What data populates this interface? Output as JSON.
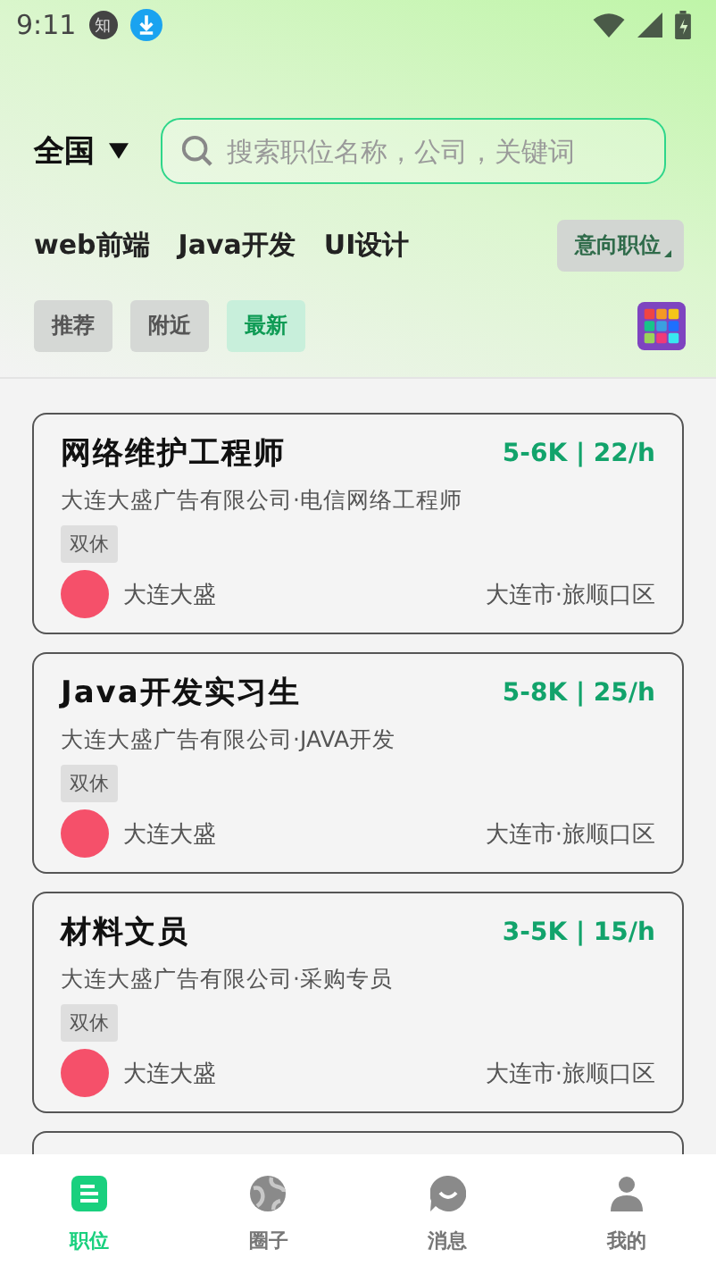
{
  "status_bar": {
    "time": "9:11",
    "app_badge": "知"
  },
  "location": {
    "label": "全国"
  },
  "search": {
    "placeholder": "搜索职位名称，公司，关键词"
  },
  "categories": [
    {
      "label": "web前端"
    },
    {
      "label": "Java开发"
    },
    {
      "label": "UI设计"
    }
  ],
  "intent_button": {
    "label": "意向职位"
  },
  "filters": [
    {
      "label": "推荐",
      "selected": false
    },
    {
      "label": "附近",
      "selected": false
    },
    {
      "label": "最新",
      "selected": true
    }
  ],
  "jobs": [
    {
      "title": "网络维护工程师",
      "salary": "5-6K | 22/h",
      "subtitle": "大连大盛广告有限公司·电信网络工程师",
      "tags": [
        "双休"
      ],
      "company": "大连大盛",
      "location": "大连市·旅顺口区"
    },
    {
      "title": "Java开发实习生",
      "salary": "5-8K | 25/h",
      "subtitle": "大连大盛广告有限公司·JAVA开发",
      "tags": [
        "双休"
      ],
      "company": "大连大盛",
      "location": "大连市·旅顺口区"
    },
    {
      "title": "材料文员",
      "salary": "3-5K | 15/h",
      "subtitle": "大连大盛广告有限公司·采购专员",
      "tags": [
        "双休"
      ],
      "company": "大连大盛",
      "location": "大连市·旅顺口区"
    }
  ],
  "nav": [
    {
      "label": "职位",
      "selected": true
    },
    {
      "label": "圈子",
      "selected": false
    },
    {
      "label": "消息",
      "selected": false
    },
    {
      "label": "我的",
      "selected": false
    }
  ]
}
